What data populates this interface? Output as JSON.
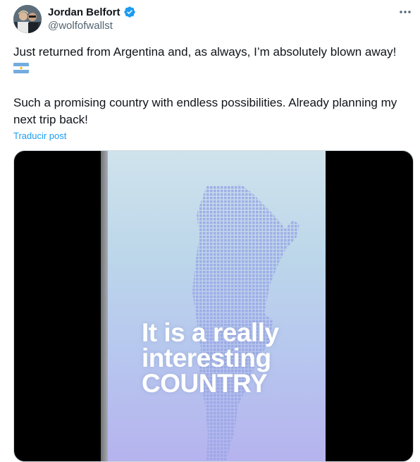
{
  "author": {
    "name": "Jordan Belfort",
    "handle": "@wolfofwallst",
    "verified": true,
    "verified_icon": "verified-badge-icon"
  },
  "tweet": {
    "line1": "Just returned from Argentina and, as always, I’m absolutely blown away!",
    "flag_icon": "argentina-flag-icon",
    "line2": "Such a promising country with endless possibilities. Already planning my next trip back!",
    "translate_label": "Traducir post"
  },
  "media": {
    "overlay_lines": [
      "It is a really",
      "interesting",
      "COUNTRY"
    ]
  },
  "colors": {
    "accent": "#1d9bf0",
    "text": "#0f1419",
    "muted": "#536471"
  }
}
